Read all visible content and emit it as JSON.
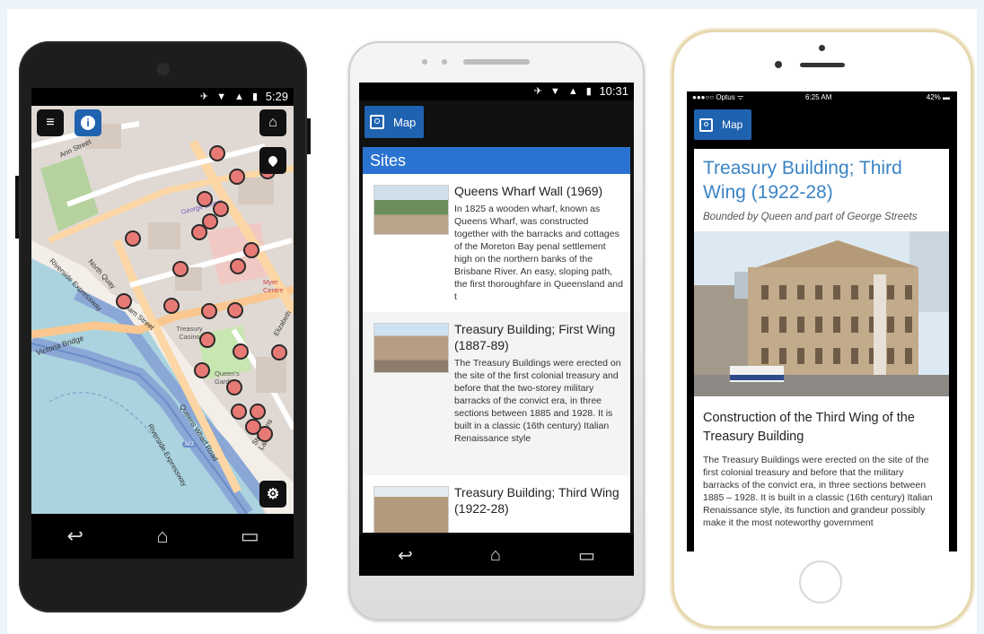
{
  "phone1": {
    "status": {
      "icons": "✈ ▼ ▲ ▮",
      "time": "5:29"
    },
    "map": {
      "menu_icon": "hamburger-icon",
      "info_icon": "info-icon",
      "home_icon": "home-icon",
      "location_icon": "location-pin-icon",
      "settings_icon": "gear-icon",
      "accent": "#1f62b0",
      "labels": {
        "north_quay": "North Quay",
        "william_street": "William Street",
        "victoria_bridge": "Victoria Bridge",
        "riverside_expressway": "Riverside Expressway",
        "riverside_expressway_2": "Riverside Expressway",
        "queens_wharf_road": "Queens Wharf Road",
        "stephens_lane": "Stephens Lane",
        "treasury_casino": "Treasury Casino",
        "queens_gardens": "Queen's Gardens",
        "myer_centre": "Myer Centre",
        "ann_street": "Ann Street",
        "george_street": "George Street",
        "m3": "M3",
        "elizabeth": "Elizabeth"
      }
    }
  },
  "phone2": {
    "status": {
      "icons": "✈ ▼ ▲ ▮",
      "time": "10:31"
    },
    "map_button": "Map",
    "sites_header": "Sites",
    "sites": [
      {
        "title": "Queens Wharf Wall (1969)",
        "desc": "In 1825 a wooden wharf, known as Queens Wharf, was constructed together with the barracks and cottages of the Moreton Bay penal settlement high on the northern banks of the Brisbane River. An easy, sloping path, the first thoroughfare in Queensland and t"
      },
      {
        "title": "Treasury Building; First Wing (1887-89)",
        "desc": "The Treasury Buildings were erected on the site of the first colonial treasury and before that the two-storey military barracks of the convict era, in three sections between 1885 and 1928. It is built in a classic (16th century) Italian Renaissance style"
      },
      {
        "title": "Treasury Building; Third Wing (1922-28)",
        "desc": ""
      }
    ]
  },
  "phone3": {
    "status": {
      "carrier": "●●●○○ Optus ᯤ",
      "time": "6:25 AM",
      "battery": "42% ▬"
    },
    "map_button": "Map",
    "title": "Treasury Building; Third Wing (1922-28)",
    "subtitle": "Bounded by Queen and part of George Streets",
    "heading": "Construction of the Third Wing of the Treasury Building",
    "body": "The Treasury Buildings were erected on the site of the first colonial treasury and before that the military barracks of the convict era, in three sections between 1885 – 1928. It is built in a classic (16th century) Italian Renaissance style, its function and grandeur possibly make it the most noteworthy government"
  },
  "nav": {
    "back_icon": "back-icon",
    "home_icon": "home-outline-icon",
    "recents_icon": "recents-icon"
  }
}
